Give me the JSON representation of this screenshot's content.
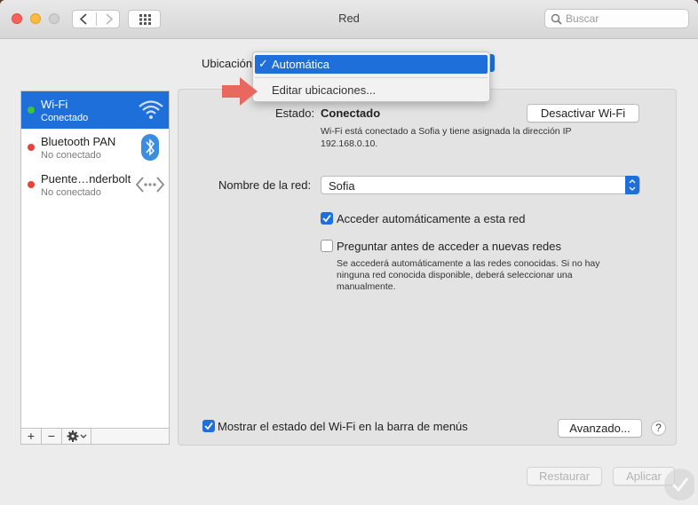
{
  "window": {
    "title": "Red"
  },
  "toolbar": {
    "search_placeholder": "Buscar"
  },
  "location": {
    "label": "Ubicación",
    "options": [
      {
        "label": "Automática",
        "selected": true
      },
      {
        "label": "Editar ubicaciones...",
        "selected": false
      }
    ]
  },
  "services": [
    {
      "name": "Wi-Fi",
      "status": "Conectado",
      "dot_color": "#3cc43c",
      "icon": "wifi-icon",
      "selected": true
    },
    {
      "name": "Bluetooth PAN",
      "status": "No conectado",
      "dot_color": "#e5433c",
      "icon": "bluetooth-icon",
      "selected": false
    },
    {
      "name": "Puente…nderbolt",
      "status": "No conectado",
      "dot_color": "#e5433c",
      "icon": "thunderbolt-bridge-icon",
      "selected": false
    }
  ],
  "detail": {
    "status_label": "Estado:",
    "status_value": "Conectado",
    "toggle_button": "Desactivar Wi-Fi",
    "status_description": [
      "Wi-Fi está conectado a Sofia y tiene asignada la dirección IP",
      "192.168.0.10."
    ],
    "network_name_label": "Nombre de la red:",
    "network_name_value": "Sofia",
    "auto_join_label": "Acceder automáticamente a esta red",
    "auto_join_checked": true,
    "ask_join_label": "Preguntar antes de acceder a nuevas redes",
    "ask_join_checked": false,
    "ask_join_help": [
      "Se accederá automáticamente a las redes conocidas. Si no hay",
      "ninguna red conocida disponible, deberá seleccionar una",
      "manualmente."
    ],
    "show_menu_status_label": "Mostrar el estado del Wi-Fi en la barra de menús",
    "show_menu_status_checked": true,
    "advanced_button": "Avanzado...",
    "help_symbol": "?"
  },
  "footer": {
    "revert_button": "Restaurar",
    "apply_button": "Aplicar"
  },
  "colors": {
    "accent": "#1e6fd9",
    "arrow": "#e8675f"
  }
}
